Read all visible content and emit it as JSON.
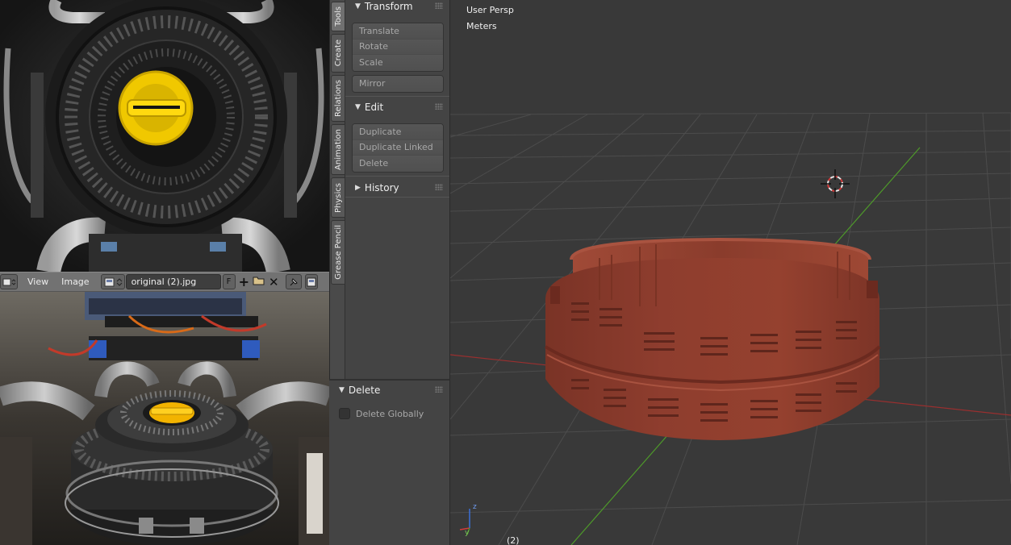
{
  "left_editor": {
    "header": {
      "menus": [
        "View",
        "Image"
      ],
      "image_name": "original (2).jpg",
      "fake_user_label": "F"
    }
  },
  "tool_shelf": {
    "tabs": [
      "Tools",
      "Create",
      "Relations",
      "Animation",
      "Physics",
      "Grease Pencil"
    ],
    "active_tab": "Tools",
    "panels": {
      "transform": {
        "title": "Transform",
        "buttons": [
          "Translate",
          "Rotate",
          "Scale"
        ],
        "mirror": "Mirror"
      },
      "edit": {
        "title": "Edit",
        "buttons": [
          "Duplicate",
          "Duplicate Linked",
          "Delete"
        ]
      },
      "history": {
        "title": "History"
      }
    },
    "operator_panel": {
      "title": "Delete",
      "option_label": "Delete Globally",
      "option_checked": false
    }
  },
  "viewport": {
    "view_name": "User Persp",
    "units": "Meters",
    "object_info": "(2)",
    "axis_labels": {
      "z": "z",
      "y": "y"
    }
  },
  "colors": {
    "model": "#8e3d2e",
    "x_axis": "#9a2f2f",
    "y_axis": "#4e9a2a",
    "grid": "#4c4c4c"
  }
}
